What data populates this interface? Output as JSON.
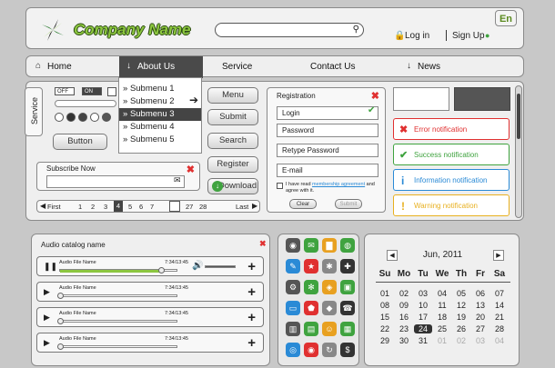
{
  "header": {
    "company_name": "Company Name",
    "login_label": "Log in",
    "signup_label": "Sign Up",
    "language": "En"
  },
  "nav": {
    "items": [
      "Home",
      "About Us",
      "Service",
      "Contact Us",
      "News"
    ]
  },
  "submenu": {
    "items": [
      "Submenu 1",
      "Submenu 2",
      "Submenu 3",
      "Submenu 4",
      "Submenu 5"
    ],
    "selected": "Submenu 3"
  },
  "side_tab": "Service",
  "toggles": [
    "OFF",
    "ON"
  ],
  "buttons": {
    "button": "Button",
    "menu": "Menu",
    "submit": "Submit",
    "search": "Search",
    "register": "Register",
    "download": "Download"
  },
  "subscribe": {
    "title": "Subscribe Now"
  },
  "pagination": {
    "first": "First",
    "last": "Last",
    "pages": [
      "1",
      "2",
      "3",
      "4",
      "5",
      "6",
      "7",
      "27",
      "28"
    ],
    "current": "4"
  },
  "registration": {
    "title": "Registration",
    "fields": [
      "Login",
      "Password",
      "Retype Password",
      "E-mail"
    ],
    "agree_text_1": "I have read ",
    "agree_link": "membership agreement",
    "agree_text_2": " and agree with it.",
    "clear": "Clear",
    "submit": "Submit"
  },
  "notifications": [
    {
      "text": "Error notification",
      "color": "#e03030",
      "icon": "x"
    },
    {
      "text": "Success notification",
      "color": "#3fa33f",
      "icon": "✓"
    },
    {
      "text": "Information notification",
      "color": "#2a8ad6",
      "icon": "i"
    },
    {
      "text": "Warning notification",
      "color": "#e8b020",
      "icon": "!"
    }
  ],
  "audio": {
    "title": "Audio catalog name",
    "tracks": [
      {
        "name": "Audio File Name",
        "time": "7:34/13:45",
        "progress": 0.85,
        "playing": true
      },
      {
        "name": "Audio File Name",
        "time": "7:34/13:45",
        "progress": 0.0,
        "playing": false
      },
      {
        "name": "Audio File Name",
        "time": "7:34/13:45",
        "progress": 0.0,
        "playing": false
      },
      {
        "name": "Audio File Name",
        "time": "7:34/13:45",
        "progress": 0.0,
        "playing": false
      }
    ]
  },
  "calendar": {
    "title": "Jun, 2011",
    "weekdays": [
      "Su",
      "Mo",
      "Tu",
      "We",
      "Th",
      "Fr",
      "Sa"
    ],
    "weeks": [
      [
        "01",
        "02",
        "03",
        "04",
        "05",
        "06",
        "07"
      ],
      [
        "08",
        "09",
        "10",
        "11",
        "12",
        "13",
        "14"
      ],
      [
        "15",
        "16",
        "17",
        "18",
        "19",
        "20",
        "21"
      ],
      [
        "22",
        "23",
        "24",
        "25",
        "26",
        "27",
        "28"
      ],
      [
        "29",
        "30",
        "31",
        "01",
        "02",
        "03",
        "04"
      ]
    ],
    "today": "24",
    "first_row_muted": true
  },
  "icon_grid": [
    [
      "chrome-icon",
      "chat-icon",
      "folder-icon",
      "globe-icon"
    ],
    [
      "pin-icon",
      "star-icon",
      "gear-icon",
      "mic-icon"
    ],
    [
      "settings-icon",
      "snowflake-icon",
      "palette-icon",
      "cart-icon"
    ],
    [
      "money-icon",
      "shield-icon",
      "chat-bubble-icon",
      "phone-icon"
    ],
    [
      "trash-icon",
      "camera-icon",
      "people-icon",
      "document-icon"
    ],
    [
      "gamepad-icon",
      "eye-icon",
      "refresh-icon",
      "dollar-icon"
    ],
    [
      "save-icon",
      "gear2-icon",
      "music-icon",
      "info-icon"
    ]
  ]
}
